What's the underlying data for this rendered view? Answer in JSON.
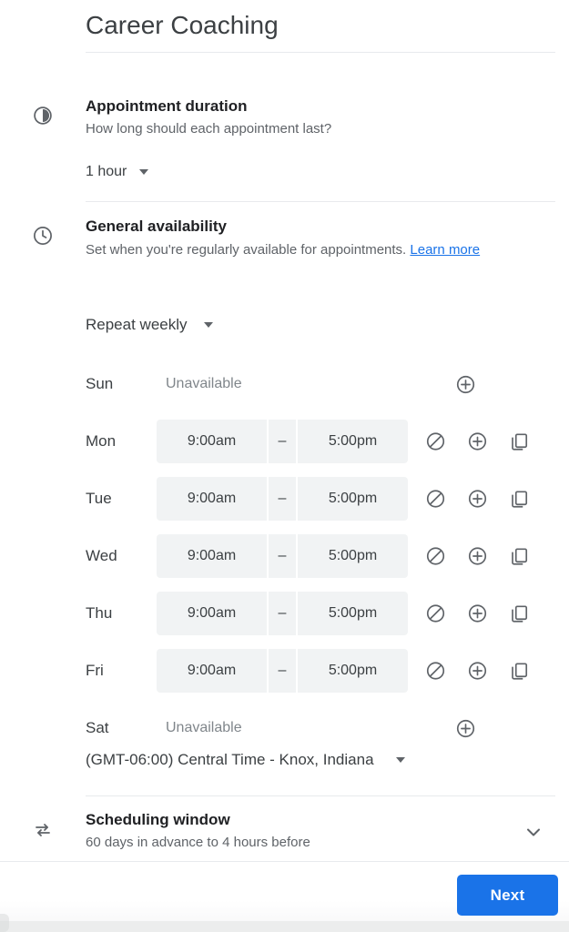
{
  "header": {
    "title": "Career Coaching"
  },
  "duration_section": {
    "icon": "timer-icon",
    "title": "Appointment duration",
    "subtitle": "How long should each appointment last?",
    "select": {
      "name": "duration-select",
      "value": "1 hour",
      "caret_icon": "chevron-down-icon"
    }
  },
  "availability_section": {
    "icon": "clock-icon",
    "title": "General availability",
    "subtitle_text": "Set when you're regularly available for appointments.",
    "link_label": "Learn more",
    "link_color": "#1a73e8",
    "repeat_select": {
      "name": "repeat-select",
      "value": "Repeat weekly",
      "caret_icon": "chevron-down-icon"
    },
    "row_icons": {
      "block": "block-icon",
      "add": "add-circle-icon",
      "duplicate": "duplicate-icon"
    },
    "days": [
      {
        "label": "Sun",
        "available": false,
        "unavailable_label": "Unavailable",
        "start": "",
        "end": "",
        "dash": ""
      },
      {
        "label": "Mon",
        "available": true,
        "unavailable_label": "",
        "start": "9:00am",
        "end": "5:00pm",
        "dash": "–"
      },
      {
        "label": "Tue",
        "available": true,
        "unavailable_label": "",
        "start": "9:00am",
        "end": "5:00pm",
        "dash": "–"
      },
      {
        "label": "Wed",
        "available": true,
        "unavailable_label": "",
        "start": "9:00am",
        "end": "5:00pm",
        "dash": "–"
      },
      {
        "label": "Thu",
        "available": true,
        "unavailable_label": "",
        "start": "9:00am",
        "end": "5:00pm",
        "dash": "–"
      },
      {
        "label": "Fri",
        "available": true,
        "unavailable_label": "",
        "start": "9:00am",
        "end": "5:00pm",
        "dash": "–"
      },
      {
        "label": "Sat",
        "available": false,
        "unavailable_label": "Unavailable",
        "start": "",
        "end": "",
        "dash": ""
      }
    ],
    "timezone": {
      "name": "timezone-select",
      "value": "(GMT-06:00) Central Time - Knox, Indiana",
      "caret_icon": "chevron-down-icon"
    }
  },
  "scheduling_window_section": {
    "icon": "swap-arrows-icon",
    "title": "Scheduling window",
    "subtitle": "60 days in advance to 4 hours before",
    "expand_icon": "chevron-down-icon"
  },
  "footer": {
    "next_label": "Next",
    "next_color": "#1a73e8"
  }
}
